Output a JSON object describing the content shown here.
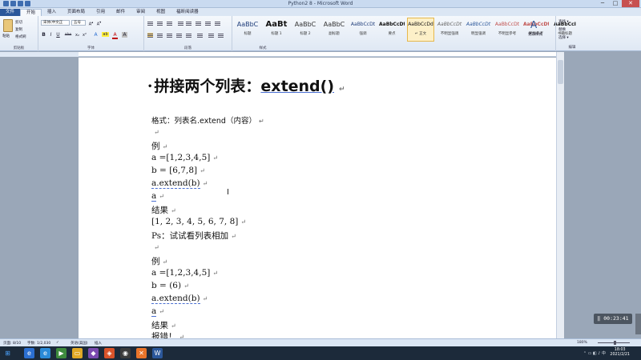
{
  "window": {
    "title": "Python2 8 - Microsoft Word",
    "minimize_glyph": "─",
    "maximize_glyph": "□",
    "close_glyph": "✕"
  },
  "tabs": [
    "文件",
    "开始",
    "插入",
    "页面布局",
    "引用",
    "邮件",
    "审阅",
    "视图",
    "福昕阅读器"
  ],
  "ribbon": {
    "clipboard": {
      "paste": "粘贴",
      "cut": "剪切",
      "copy": "复制",
      "format_painter": "格式刷",
      "label": "剪贴板"
    },
    "font": {
      "name": "宋体(中文正",
      "size": "五号",
      "label": "字体",
      "bold": "B",
      "italic": "I",
      "underline": "U",
      "strikethrough": "abe",
      "subscript": "x₂",
      "superscript": "x²",
      "text_effect": "A",
      "highlight": "ab",
      "font_color": "A",
      "char_shade": "A"
    },
    "paragraph": {
      "label": "段落"
    },
    "styles": {
      "label": "样式",
      "items": [
        {
          "sample": "AaBbC",
          "name": "标题"
        },
        {
          "sample": "AaBt",
          "name": "标题 1"
        },
        {
          "sample": "AaBbC",
          "name": "标题 2"
        },
        {
          "sample": "AaBbC",
          "name": "副标题"
        },
        {
          "sample": "AaBbCcDt",
          "name": "强调"
        },
        {
          "sample": "AaBbCcDt",
          "name": "要点"
        },
        {
          "sample": "AaBbCcDd",
          "name": "↵ 正文"
        },
        {
          "sample": "AaBbCcDt",
          "name": "不明显强调"
        },
        {
          "sample": "AaBbCcDt",
          "name": "明显强调"
        },
        {
          "sample": "AaBbCcDt",
          "name": "不明显参考"
        },
        {
          "sample": "AaBbCcDt",
          "name": "明显参考"
        },
        {
          "sample": "AaBbCcI",
          "name": "书籍标题"
        }
      ]
    },
    "change_styles": "更改样式",
    "editing": {
      "find": "查找 ▾",
      "replace": "替换",
      "select": "选择 ▾",
      "label": "编辑"
    }
  },
  "document": {
    "heading_text": "拼接两个列表：",
    "heading_code": "extend()",
    "lines": [
      "格式：列表名.extend（内容）",
      "",
      "例",
      "a =[1,2,3,4,5]",
      "b = [6,7,8]",
      "a.extend(b)",
      "a",
      "结果",
      "[1, 2, 3, 4, 5, 6, 7, 8]",
      "Ps：试试看列表相加",
      "",
      "例",
      "a =[1,2,3,4,5]",
      "b = (6)",
      "a.extend(b)",
      "a",
      "结果",
      "报错！"
    ]
  },
  "video": {
    "time": "00:23:41"
  },
  "statusbar": {
    "page": "页面: 8/10",
    "words": "字数: 1/2,030",
    "lang": "英语(美国)",
    "mode": "插入",
    "zoom": "180%"
  },
  "taskbar": {
    "time": "18:03",
    "date": "2021/2/21"
  }
}
